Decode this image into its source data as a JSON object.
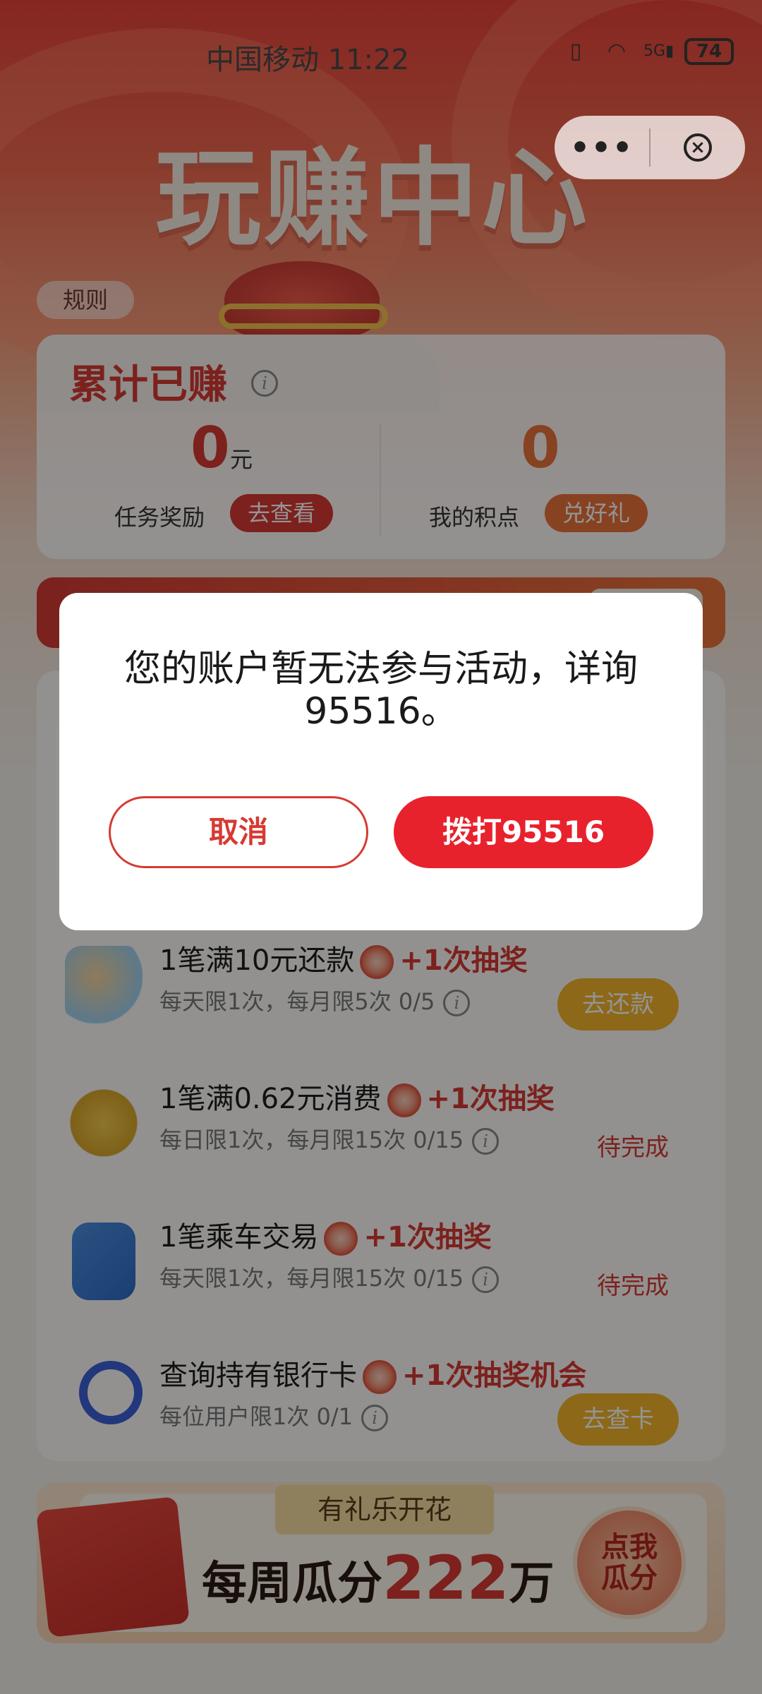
{
  "status_bar": {
    "carrier": "中国移动",
    "time": "11:22",
    "signal_label": "5G",
    "battery": "74"
  },
  "capsule": {
    "more_label": "•••",
    "close_label": "×"
  },
  "header": {
    "title": "玩赚中心",
    "rules_label": "规则"
  },
  "earnings": {
    "title": "累计已赚",
    "reward_value": "0",
    "reward_unit": "元",
    "reward_label": "任务奖励",
    "reward_button": "去查看",
    "points_value": "0",
    "points_label": "我的积点",
    "points_button": "兑好礼"
  },
  "tasks": [
    {
      "title": "1笔满10元还款",
      "reward": "+1次抽奖",
      "limit": "每天限1次，每月限5次",
      "progress": "0/5",
      "action": "去还款",
      "action_type": "button"
    },
    {
      "title": "1笔满0.62元消费",
      "reward": "+1次抽奖",
      "limit": "每日限1次，每月限15次",
      "progress": "0/15",
      "action": "待完成",
      "action_type": "text"
    },
    {
      "title": "1笔乘车交易",
      "reward": "+1次抽奖",
      "limit": "每天限1次，每月限15次",
      "progress": "0/15",
      "action": "待完成",
      "action_type": "text"
    },
    {
      "title": "查询持有银行卡",
      "reward": "+1次抽奖机会",
      "limit": "每位用户限1次",
      "progress": "0/1",
      "action": "去查卡",
      "action_type": "button"
    }
  ],
  "banner": {
    "tag": "有礼乐开花",
    "text_prefix": "每周瓜分",
    "amount": "222",
    "unit": "万",
    "badge": "点我瓜分"
  },
  "dialog": {
    "message": "您的账户暂无法参与活动，详询95516。",
    "cancel_label": "取消",
    "call_label": "拨打95516"
  },
  "colors": {
    "brand_red": "#e8222d",
    "text_red": "#d63a32",
    "gold": "#f2b42a",
    "orange": "#e9733c"
  }
}
